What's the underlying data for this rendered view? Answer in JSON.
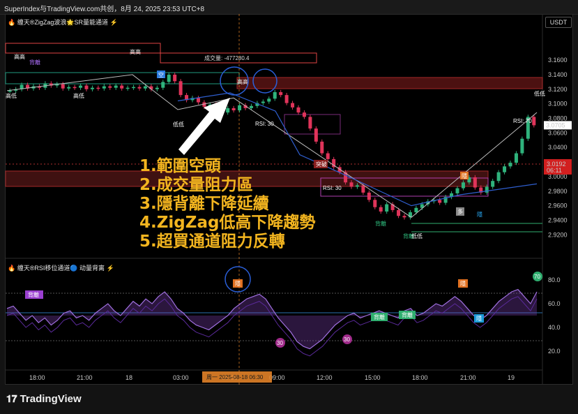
{
  "header": {
    "title": "SuperIndex与TradingView.com共创，8月 24, 2025 23:53 UTC+8"
  },
  "pane1": {
    "indicator": "🔥 缠天®ZigZag波浪🌟SR量能通道 ⚡",
    "currency": "USDT"
  },
  "pane2": {
    "indicator": "🔥 缠天®RSI移位通道🔵 动量背离 ⚡"
  },
  "annotations": [
    "1.範圍空頭",
    "2.成交量阻力區",
    "3.隱背離下降延續",
    "4.ZigZag低高下降趨勢",
    "5.超買通道阻力反轉"
  ],
  "labels": {
    "volume": "成交量: -477280.4",
    "high1": "高高",
    "high2": "高高",
    "divergence_bear": "背離",
    "low_left": "高低",
    "low_mid": "高低",
    "low_low": "低低",
    "short": "空",
    "high_circle": "高高",
    "breakout": "突破",
    "rsi30a": "RSI: 30",
    "rsi30b": "RSI: 30",
    "rsi70": "RSI: 70",
    "hidden_bear_right": "隱",
    "div_bull1": "背離",
    "div_bull2": "背離",
    "low_bottom": "低低",
    "peak_low": "低低",
    "s_box": "多",
    "hidden_bull": "隱",
    "rsi_div1": "背離",
    "rsi_hidden": "隱",
    "rsi_hidden2": "隱",
    "rsi_div_bull1": "背離",
    "rsi_div_bull2": "背離",
    "rsi_hidden_bull": "隱",
    "rsi_30a": "30",
    "rsi_30b": "30",
    "rsi_70": "70"
  },
  "price_badges": {
    "last": "3.0705",
    "current": "3.0192",
    "countdown": "06:11"
  },
  "crosshair_time": "周一  2025-08-18  06:30",
  "footer": {
    "brand": "TradingView"
  },
  "chart_data": [
    {
      "type": "candlestick",
      "title": "",
      "ylim": [
        2.905,
        3.185
      ],
      "y_ticks": [
        3.16,
        3.14,
        3.12,
        3.1,
        3.08,
        3.06,
        3.04,
        3.02,
        3.0,
        2.98,
        2.96,
        2.94,
        2.92
      ],
      "x_ticks": [
        "18:00",
        "21:00",
        "18",
        "03:00",
        "06:00",
        "09:00",
        "12:00",
        "15:00",
        "18:00",
        "21:00",
        "19"
      ],
      "close_path": [
        3.118,
        3.12,
        3.126,
        3.121,
        3.124,
        3.122,
        3.128,
        3.125,
        3.127,
        3.121,
        3.123,
        3.122,
        3.125,
        3.12,
        3.122,
        3.121,
        3.124,
        3.122,
        3.125,
        3.121,
        3.122,
        3.123,
        3.121,
        3.124,
        3.12,
        3.122,
        3.13,
        3.14,
        3.131,
        3.112,
        3.105,
        3.108,
        3.102,
        3.096,
        3.099,
        3.093,
        3.088,
        3.094,
        3.091,
        3.098,
        3.094,
        3.097,
        3.101,
        3.103,
        3.107,
        3.116,
        3.112,
        3.101,
        3.095,
        3.088,
        3.082,
        3.066,
        3.048,
        3.032,
        3.024,
        3.013,
        3.006,
        2.992,
        2.986,
        2.988,
        2.978,
        2.968,
        2.958,
        2.952,
        2.962,
        2.954,
        2.946,
        2.944,
        2.951,
        2.957,
        2.962,
        2.966,
        2.968,
        2.964,
        2.972,
        2.977,
        2.984,
        2.992,
        2.999,
        2.985,
        2.978,
        2.986,
        2.994,
        3.006,
        3.014,
        3.019,
        3.032,
        3.052,
        3.082,
        3.0705
      ],
      "levels": {
        "last": 3.0705,
        "current": 3.0192
      }
    },
    {
      "type": "line",
      "title": "",
      "ylim": [
        10,
        90
      ],
      "y_ticks": [
        80.0,
        60.0,
        40.0,
        20.0
      ],
      "series": [
        {
          "values": [
            56,
            58,
            52,
            46,
            50,
            44,
            48,
            42,
            46,
            52,
            54,
            48,
            50,
            46,
            52,
            56,
            60,
            54,
            50,
            56,
            62,
            58,
            64,
            60,
            66,
            70,
            64,
            56,
            52,
            46,
            42,
            40,
            38,
            42,
            46,
            50,
            56,
            60,
            64,
            66,
            68,
            64,
            56,
            48,
            42,
            36,
            28,
            24,
            22,
            26,
            30,
            36,
            42,
            46,
            50,
            52,
            48,
            50,
            52,
            54,
            52,
            50,
            48,
            54,
            56,
            50,
            52,
            56,
            60,
            58,
            62,
            66,
            62,
            56,
            50,
            46,
            50,
            56,
            62,
            66,
            70,
            72,
            66,
            60,
            70
          ]
        }
      ],
      "levels": [
        80,
        70,
        50,
        30
      ]
    }
  ]
}
